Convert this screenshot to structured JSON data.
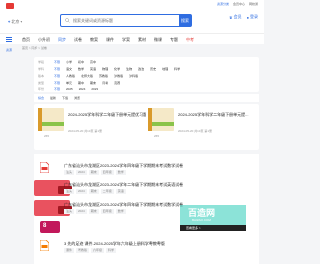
{
  "header": {
    "location": "北京",
    "search_placeholder": "搜索关键词或资源标题",
    "search_button": "搜索",
    "top_links": [
      "资源分类",
      "会员中心",
      "网校通"
    ],
    "user": {
      "vip": "会员",
      "login": "登录"
    }
  },
  "nav": {
    "items": [
      "首页",
      "小升初",
      "同步",
      "试卷",
      "教案",
      "课件",
      "学案",
      "素材",
      "微课",
      "专题",
      "中考"
    ],
    "active": 2
  },
  "breadcrumb": "首页 > 同步 > 试卷",
  "sidebar": {
    "title": "资源"
  },
  "filters": [
    {
      "label": "学段",
      "options": [
        "不限",
        "小学",
        "初中",
        "高中"
      ],
      "selected": 0
    },
    {
      "label": "学科",
      "options": [
        "不限",
        "语文",
        "数学",
        "英语",
        "物理",
        "化学",
        "生物",
        "政治",
        "历史",
        "地理",
        "科学"
      ],
      "selected": 0
    },
    {
      "label": "版本",
      "options": [
        "不限",
        "人教版",
        "北师大版",
        "苏教版",
        "沪教版",
        "沪科版"
      ],
      "selected": 0
    },
    {
      "label": "类型",
      "options": [
        "不限",
        "单元",
        "期中",
        "期末",
        "月考",
        "竞赛"
      ],
      "selected": 0
    },
    {
      "label": "年份",
      "options": [
        "不限",
        "2025",
        "2024",
        "2023"
      ],
      "selected": 0
    }
  ],
  "sort": [
    "综合",
    "最新",
    "下载",
    "浏览"
  ],
  "cards": [
    {
      "title": "2024-2025学年科学二年级下册单元提优习题...",
      "meta": "2024-05-20  共10页  第1册",
      "stat": "265"
    },
    {
      "title": "2024-2025学年科学二年级下册单元提...",
      "meta": "2024-05-20  共10页  第1册",
      "stat": "265"
    }
  ],
  "list": [
    {
      "title": "广东省汕头市龙湖区2023-2024学年四年级下学期期末考试数学试卷",
      "tags": [
        "汕头",
        "2024",
        "期末",
        "四年级",
        "数学"
      ]
    },
    {
      "title": "广东省汕头市龙湖区2023-2024学年二年级下学期期末考试英语试卷",
      "tags": [
        "汕头",
        "2024",
        "期末",
        "二年级",
        "英语"
      ]
    },
    {
      "title": "广东省汕头市龙湖区2023-2024学年四年级下学期期末考试数学试卷",
      "tags": [
        "汕头",
        "2024",
        "期末",
        "四年级",
        "数学"
      ]
    },
    {
      "title": "3 先的足迹 课件-2024-2025学年六年级上册科学粤教粤版",
      "tags": [
        "课件",
        "粤教版",
        "六年级",
        "科学"
      ]
    }
  ],
  "watermark": {
    "main": "百造网",
    "sub": "BAIZAO.COM",
    "bar": "查看更多 >"
  },
  "badge": "8"
}
